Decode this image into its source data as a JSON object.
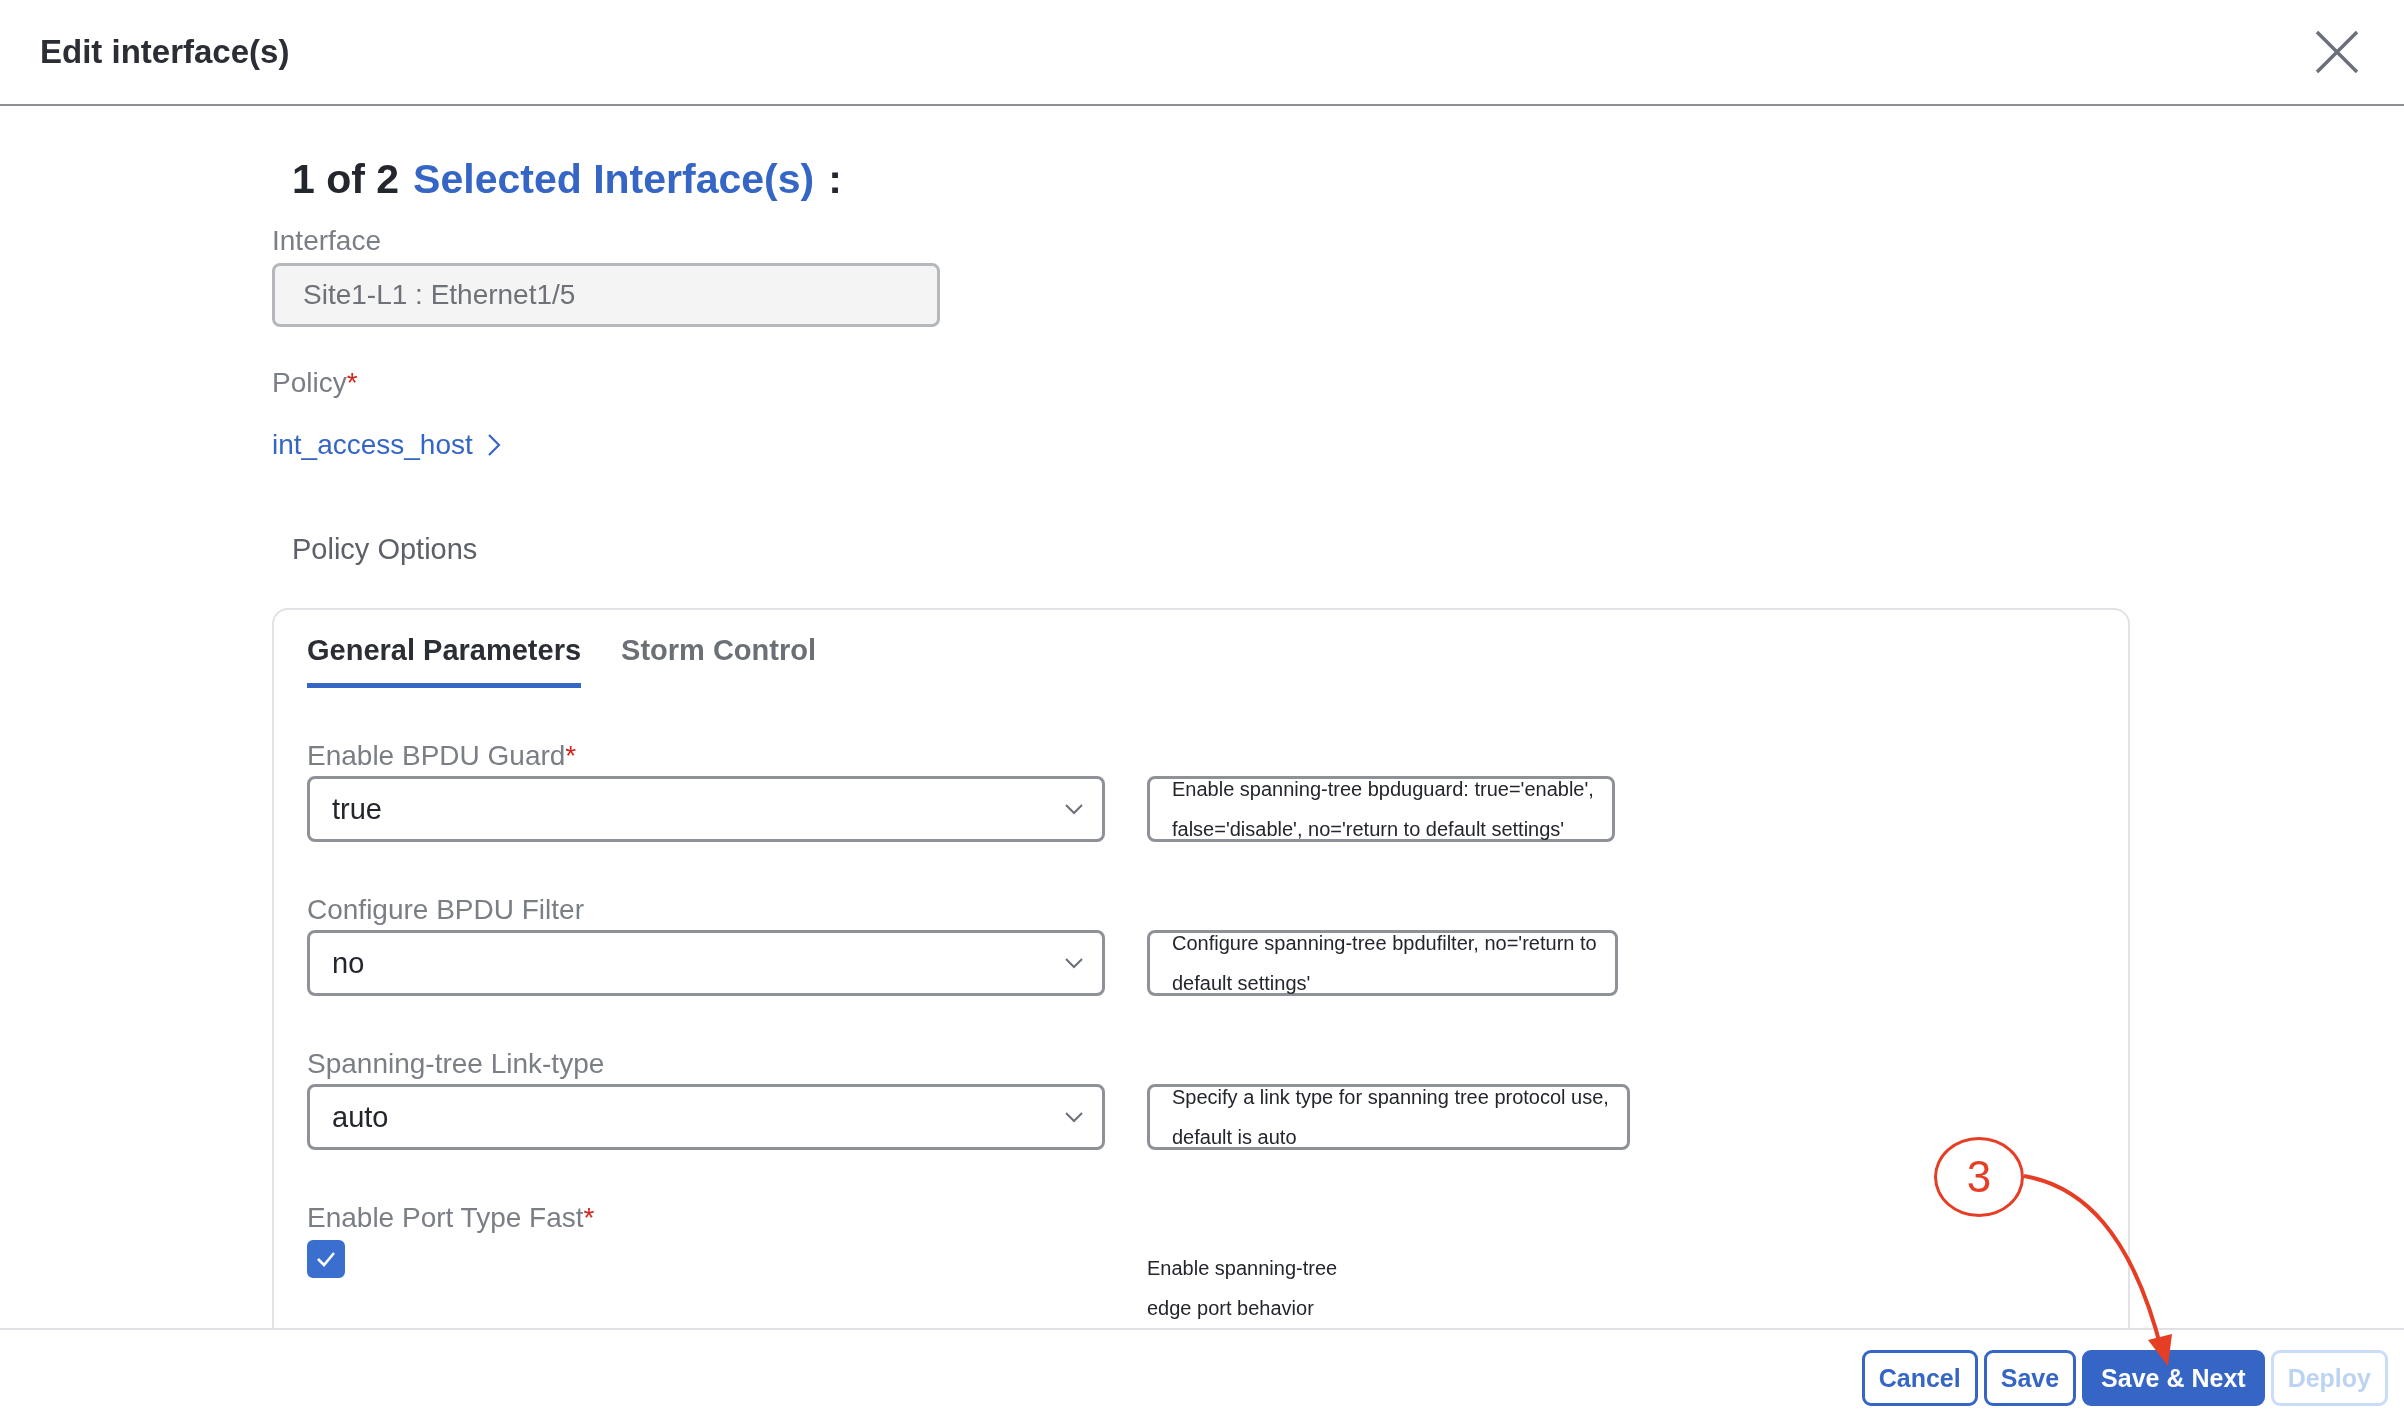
{
  "dialog": {
    "title": "Edit interface(s)"
  },
  "heading": {
    "counter": "1 of 2",
    "link": "Selected Interface(s)",
    "suffix": ":"
  },
  "interface": {
    "label": "Interface",
    "value": "Site1-L1 : Ethernet1/5",
    "disabled": true
  },
  "policy": {
    "label": "Policy",
    "required_marker": "*",
    "link": "int_access_host"
  },
  "policy_options": {
    "title": "Policy Options",
    "tabs": [
      {
        "label": "General Parameters",
        "selected": true
      },
      {
        "label": "Storm Control",
        "selected": false
      }
    ],
    "fields": [
      {
        "kind": "select",
        "label": "Enable BPDU Guard",
        "required_marker": "*",
        "value": "true",
        "help": [
          "Enable spanning-tree bpduguard: true='enable',",
          "false='disable', no='return to default settings'"
        ]
      },
      {
        "kind": "select",
        "label": "Configure BPDU Filter",
        "value": "no",
        "help": [
          "Configure spanning-tree bpdufilter, no='return to",
          "default settings'"
        ]
      },
      {
        "kind": "select",
        "label": "Spanning-tree Link-type",
        "value": "auto",
        "help": [
          "Specify a link type for spanning tree protocol use,",
          "default is auto"
        ]
      },
      {
        "kind": "checkbox",
        "label": "Enable Port Type Fast",
        "required_marker": "*",
        "checked": true,
        "help": [
          "Enable spanning-tree",
          "edge port behavior"
        ]
      }
    ]
  },
  "annotation": {
    "label": "3"
  },
  "buttons": [
    {
      "label": "Cancel",
      "kind": "outline",
      "disabled": false
    },
    {
      "label": "Save",
      "kind": "outline",
      "disabled": false
    },
    {
      "label": "Save & Next",
      "kind": "primary",
      "disabled": false
    },
    {
      "label": "Deploy",
      "kind": "outline",
      "disabled": true
    }
  ]
}
